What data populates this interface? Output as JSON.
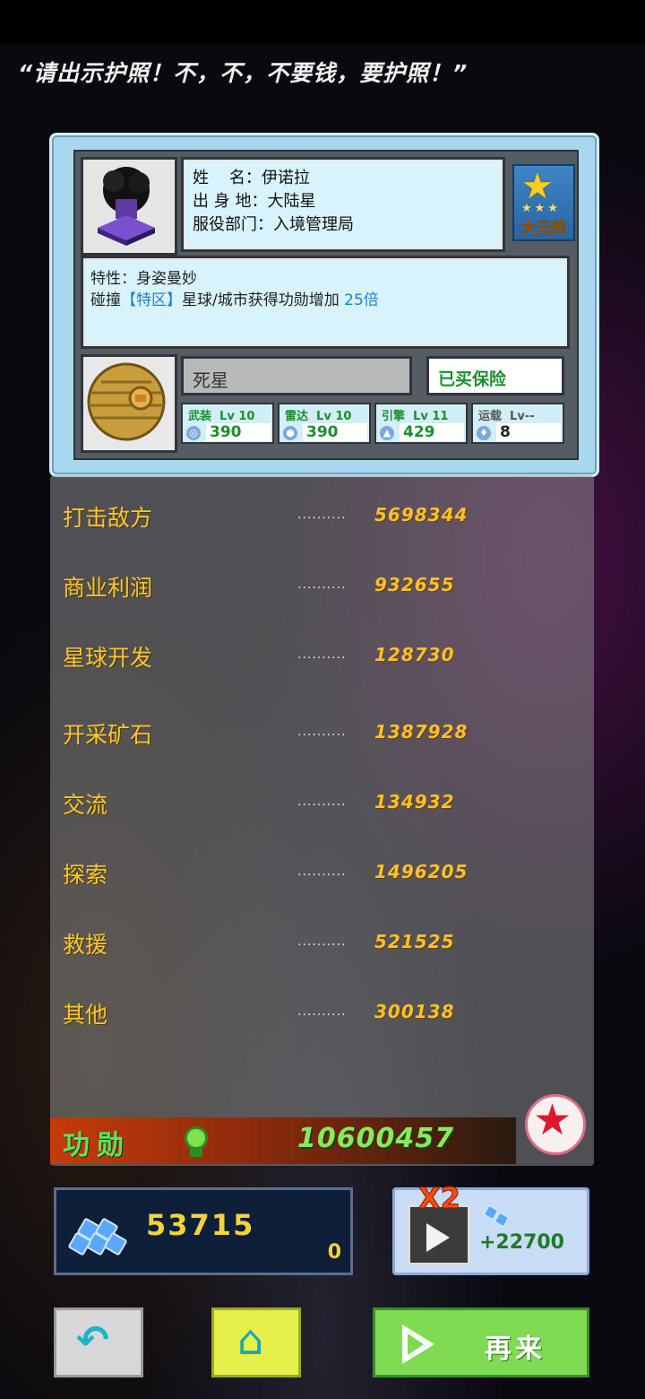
{
  "quote": "“请出示护照！不，不，不要钱，要护照！”",
  "profile": {
    "name_line": "姓    名：伊诺拉",
    "origin_line": "出 身 地：大陆星",
    "dept_line": "服役部门：入境管理局",
    "rank": "大元帅",
    "trait_line": "特性：身姿曼妙",
    "effect_prefix": "碰撞",
    "effect_tag": "【特区】",
    "effect_text": "星球/城市获得功勋增加",
    "effect_value": "25倍"
  },
  "ship": {
    "name": "死星",
    "insurance": "已买保险",
    "stats": [
      {
        "label": "武装  Lv 10",
        "value": "390"
      },
      {
        "label": "雷达  Lv 10",
        "value": "390"
      },
      {
        "label": "引擎  Lv 11",
        "value": "429"
      },
      {
        "label": "运载  Lv--",
        "value": "8"
      }
    ]
  },
  "scores": [
    {
      "name": "打击敌方",
      "value": "5698344"
    },
    {
      "name": "商业利润",
      "value": "932655"
    },
    {
      "name": "星球开发",
      "value": "128730"
    },
    {
      "name": "开采矿石",
      "value": "1387928"
    },
    {
      "name": "交流",
      "value": "134932"
    },
    {
      "name": "探索",
      "value": "1496205"
    },
    {
      "name": "救援",
      "value": "521525"
    },
    {
      "name": "其他",
      "value": "300138"
    }
  ],
  "dots": "..........",
  "merit": {
    "label": "功勋",
    "value": "10600457"
  },
  "crystals": {
    "amount": "53715",
    "extra": "0"
  },
  "bonus": {
    "multiplier": "X2",
    "gain": "+22700"
  },
  "buttons": {
    "again": "再来"
  },
  "colors": {
    "score_gold": "#f8c12a",
    "merit_green": "#8be85a",
    "again_green": "#7fdb52"
  }
}
